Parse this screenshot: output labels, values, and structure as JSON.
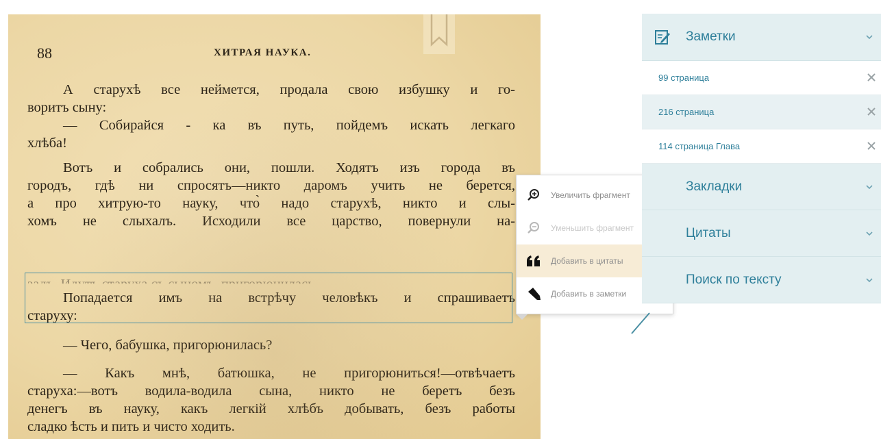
{
  "book": {
    "page_number": "88",
    "running_head": "ХИТРАЯ НАУКА.",
    "lines": [
      "А старухѣ все неймется, продала свою избушку и го-",
      "воритъ сыну:",
      "— Собирайся - ка въ путь, пойдемъ искать легкаго",
      "хлѣба!",
      "Вотъ и собрались они, пошли. Ходятъ изъ города въ",
      "городъ, гдѣ ни спросятъ—никто даромъ учить не берется,",
      "а про хитрую-то науку, что̀ надо старухѣ, никто и слы-",
      "хомъ не слыхалъ. Исходили все царство, повернули на-",
      "задъ. Идутъ старуха съ сыномъ, пригорюнилась",
      "Попадается имъ на встрѣчу человѣкъ и спрашиваетъ",
      "старуху:",
      "— Чего, бабушка, пригорюнилась?",
      "— Какъ мнѣ, батюшка, не пригорюниться!—отвѣчаетъ",
      "старуха:—вотъ водила-водила сына, никто не беретъ безъ",
      "денегъ въ науку, какъ легкій хлѣбъ добывать, безъ работы",
      "сладко ѣсть и пить и чисто ходить."
    ]
  },
  "context_menu": {
    "items": [
      {
        "label": "Увеличить фрагмент",
        "icon": "zoom-in-icon"
      },
      {
        "label": "Уменьшить фрагмент",
        "icon": "zoom-out-icon"
      },
      {
        "label": "Добавить в цитаты",
        "icon": "quote-icon"
      },
      {
        "label": "Добавить в заметки",
        "icon": "pen-icon"
      }
    ]
  },
  "side_panel": {
    "notes": {
      "title": "Заметки",
      "icon": "notes-edit-icon",
      "items": [
        {
          "label": "99 страница"
        },
        {
          "label": "216 страница"
        },
        {
          "label": "114 страница Глава"
        }
      ]
    },
    "bookmarks": {
      "title": "Закладки"
    },
    "quotes": {
      "title": "Цитаты"
    },
    "search": {
      "title": "Поиск по тексту"
    }
  },
  "colors": {
    "accent": "#2e7f9a",
    "panel_header_bg": "#e3eff1",
    "selection_border": "#4a8fa3",
    "page_paper": "#ecd7a5"
  }
}
